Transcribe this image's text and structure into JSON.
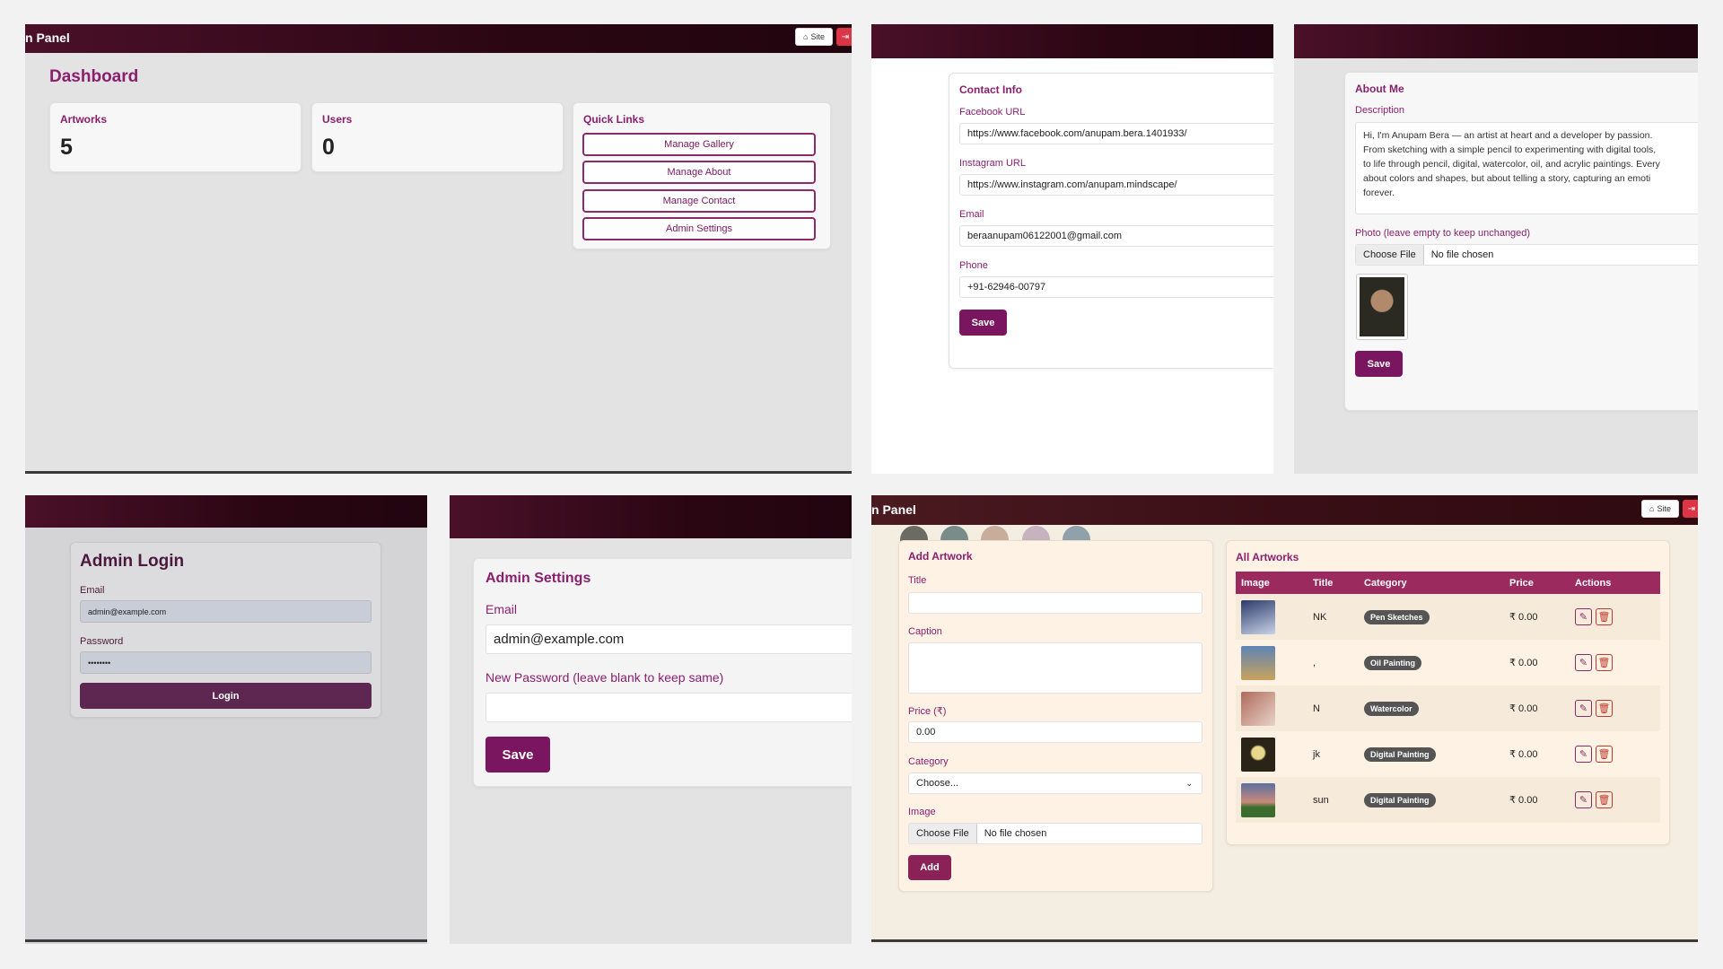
{
  "colors": {
    "brand": "#7a1660",
    "header_dark": "#2a0612",
    "danger": "#dc3545",
    "badge": "#555555",
    "table_header": "#9b2a5f"
  },
  "dashboard": {
    "brand": "n Panel",
    "site_label": "Site",
    "title": "Dashboard",
    "artworks_label": "Artworks",
    "artworks_count": "5",
    "users_label": "Users",
    "users_count": "0",
    "quick_links_title": "Quick Links",
    "quick_links": [
      "Manage Gallery",
      "Manage About",
      "Manage Contact",
      "Admin Settings"
    ]
  },
  "contact": {
    "title": "Contact Info",
    "facebook_label": "Facebook URL",
    "facebook_value": "https://www.facebook.com/anupam.bera.1401933/",
    "instagram_label": "Instagram URL",
    "instagram_value": "https://www.instagram.com/anupam.mindscape/",
    "email_label": "Email",
    "email_value": "beraanupam06122001@gmail.com",
    "phone_label": "Phone",
    "phone_value": "+91-62946-00797",
    "save_label": "Save"
  },
  "about": {
    "title": "About Me",
    "description_label": "Description",
    "description_lines": [
      "Hi, I'm Anupam Bera — an artist at heart and a developer by passion.",
      "From sketching with a simple pencil to experimenting with digital tools,",
      "to life through pencil, digital, watercolor, oil, and acrylic paintings. Every",
      "about colors and shapes, but about telling a story, capturing an emoti",
      "forever."
    ],
    "photo_label": "Photo (leave empty to keep unchanged)",
    "choose_file": "Choose File",
    "no_file": "No file chosen",
    "save_label": "Save"
  },
  "login": {
    "title": "Admin Login",
    "email_label": "Email",
    "email_value": "admin@example.com",
    "password_label": "Password",
    "password_value": "••••••••",
    "login_label": "Login"
  },
  "settings": {
    "title": "Admin Settings",
    "email_label": "Email",
    "email_value": "admin@example.com",
    "password_label": "New Password (leave blank to keep same)",
    "password_value": "",
    "save_label": "Save"
  },
  "gallery": {
    "brand": "n Panel",
    "site_label": "Site",
    "swatches": [
      "#6b6b63",
      "#7a8c8a",
      "#c9ad9c",
      "#c7b3bf",
      "#8fa2ab"
    ],
    "add_title": "Add Artwork",
    "title_label": "Title",
    "title_value": "",
    "caption_label": "Caption",
    "caption_value": "",
    "price_label": "Price (₹)",
    "price_value": "0.00",
    "category_label": "Category",
    "category_value": "Choose...",
    "image_label": "Image",
    "choose_file": "Choose File",
    "no_file": "No file chosen",
    "add_label": "Add",
    "list_title": "All Artworks",
    "columns": [
      "Image",
      "Title",
      "Category",
      "Price",
      "Actions"
    ],
    "rows": [
      {
        "title": "NK",
        "category": "Pen Sketches",
        "price": "₹ 0.00",
        "thumb": [
          "#2b3a6b",
          "#c9d3e8"
        ]
      },
      {
        "title": ",",
        "category": "Oil Painting",
        "price": "₹ 0.00",
        "thumb": [
          "#5d84b5",
          "#c9a25c"
        ]
      },
      {
        "title": "N",
        "category": "Watercolor",
        "price": "₹ 0.00",
        "thumb": [
          "#b06a5a",
          "#e7d4c8"
        ]
      },
      {
        "title": "jk",
        "category": "Digital Painting",
        "price": "₹ 0.00",
        "thumb": [
          "#2a2418",
          "#e8d98a"
        ]
      },
      {
        "title": "sun",
        "category": "Digital Painting",
        "price": "₹ 0.00",
        "thumb": [
          "#5a6fa0",
          "#3b6e2e"
        ]
      }
    ]
  }
}
